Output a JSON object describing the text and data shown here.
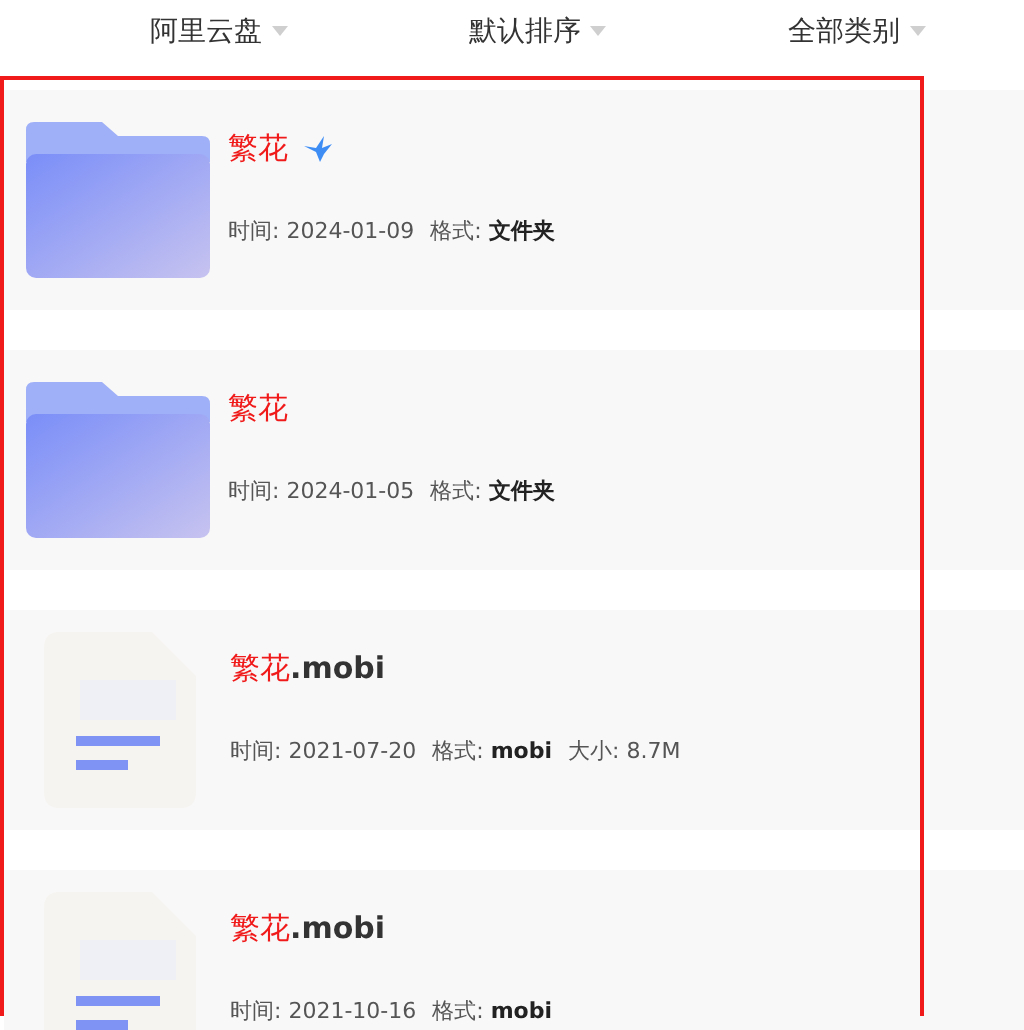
{
  "filters": [
    {
      "label": "阿里云盘"
    },
    {
      "label": "默认排序"
    },
    {
      "label": "全部类别"
    }
  ],
  "results": [
    {
      "kind": "folder",
      "keyword": "繁花",
      "marked": true,
      "time_label": "时间:",
      "time": "2024-01-09",
      "format_label": "格式:",
      "format": "文件夹"
    },
    {
      "kind": "folder",
      "keyword": "繁花",
      "marked": false,
      "time_label": "时间:",
      "time": "2024-01-05",
      "format_label": "格式:",
      "format": "文件夹"
    },
    {
      "kind": "file",
      "keyword": "繁花",
      "rest": ".mobi",
      "marked": false,
      "time_label": "时间:",
      "time": "2021-07-20",
      "format_label": "格式:",
      "format": "mobi",
      "size_label": "大小:",
      "size": "8.7M"
    },
    {
      "kind": "file",
      "keyword": "繁花",
      "rest": ".mobi",
      "marked": false,
      "time_label": "时间:",
      "time": "2021-10-16",
      "format_label": "格式:",
      "format": "mobi"
    }
  ]
}
